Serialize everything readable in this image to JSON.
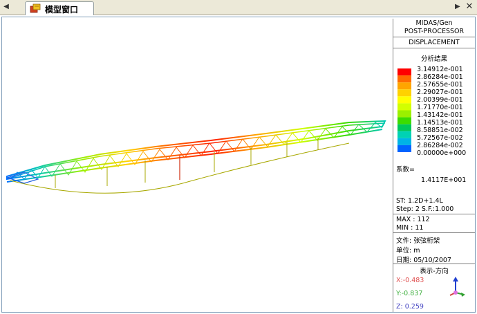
{
  "tab": {
    "title": "模型窗口",
    "nav_left": "◀",
    "nav_right": "▶",
    "close": "✕"
  },
  "legend": {
    "header_line1": "MIDAS/Gen",
    "header_line2": "POST-PROCESSOR",
    "result_type": "DISPLACEMENT",
    "subtitle": "分析结果",
    "colorbar": [
      {
        "color": "#ff0000",
        "value": "3.14912e-001"
      },
      {
        "color": "#ff6a00",
        "value": "2.86284e-001"
      },
      {
        "color": "#ffa500",
        "value": "2.57655e-001"
      },
      {
        "color": "#ffd200",
        "value": "2.29027e-001"
      },
      {
        "color": "#ffff00",
        "value": "2.00399e-001"
      },
      {
        "color": "#d2ff00",
        "value": "1.71770e-001"
      },
      {
        "color": "#9bf000",
        "value": "1.43142e-001"
      },
      {
        "color": "#3cdc00",
        "value": "1.14513e-001"
      },
      {
        "color": "#00c85a",
        "value": "8.58851e-002"
      },
      {
        "color": "#00d2b4",
        "value": "5.72567e-002"
      },
      {
        "color": "#00b4e6",
        "value": "2.86284e-002"
      },
      {
        "color": "#0064ff",
        "value": "0.00000e+000"
      }
    ],
    "factor_label": "系数=",
    "factor_value": "1.4117E+001",
    "st": "ST: 1.2D+1.4L",
    "step": "Step: 2 S.F.:1.000",
    "max": "MAX : 112",
    "min": "MIN : 11",
    "file": "文件: 张弦桁架",
    "unit": "单位: m",
    "date": "日期: 05/10/2007",
    "view_dir": "表示-方向",
    "x": "X:-0.483",
    "y": "Y:-0.837",
    "z": "Z: 0.259",
    "x_color": "#e05050",
    "y_color": "#40b040",
    "z_color": "#4040c0"
  }
}
